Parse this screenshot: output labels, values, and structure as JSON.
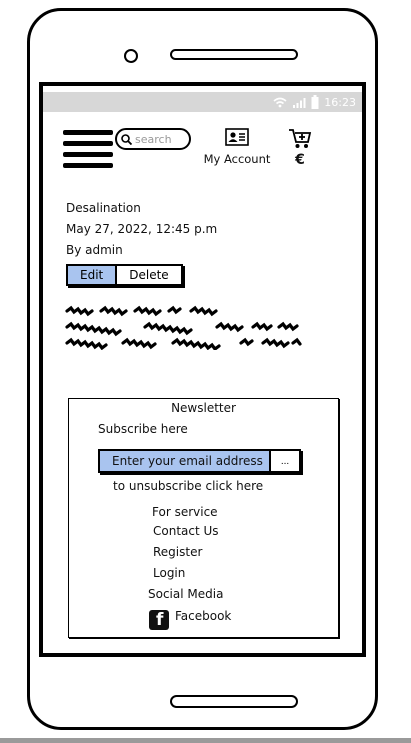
{
  "status_bar": {
    "time": "16:23"
  },
  "header": {
    "search_placeholder": "search",
    "account_label": "My Account",
    "currency_symbol": "€"
  },
  "post": {
    "title": "Desalination",
    "date": "May 27, 2022, 12:45 p.m",
    "author": "By admin",
    "edit_label": "Edit",
    "delete_label": "Delete"
  },
  "newsletter": {
    "title": "Newsletter",
    "subscribe_text": "Subscribe here",
    "email_placeholder": "Enter your email address",
    "submit_label": "...",
    "unsubscribe_text": "to unsubscribe click here"
  },
  "footer": {
    "links": [
      "For service",
      "Contact Us",
      "Register",
      "Login",
      "Social Media"
    ],
    "facebook_label": "Facebook"
  },
  "colors": {
    "accent": "#a9c4ef",
    "status_bar": "#d7d7d7"
  }
}
